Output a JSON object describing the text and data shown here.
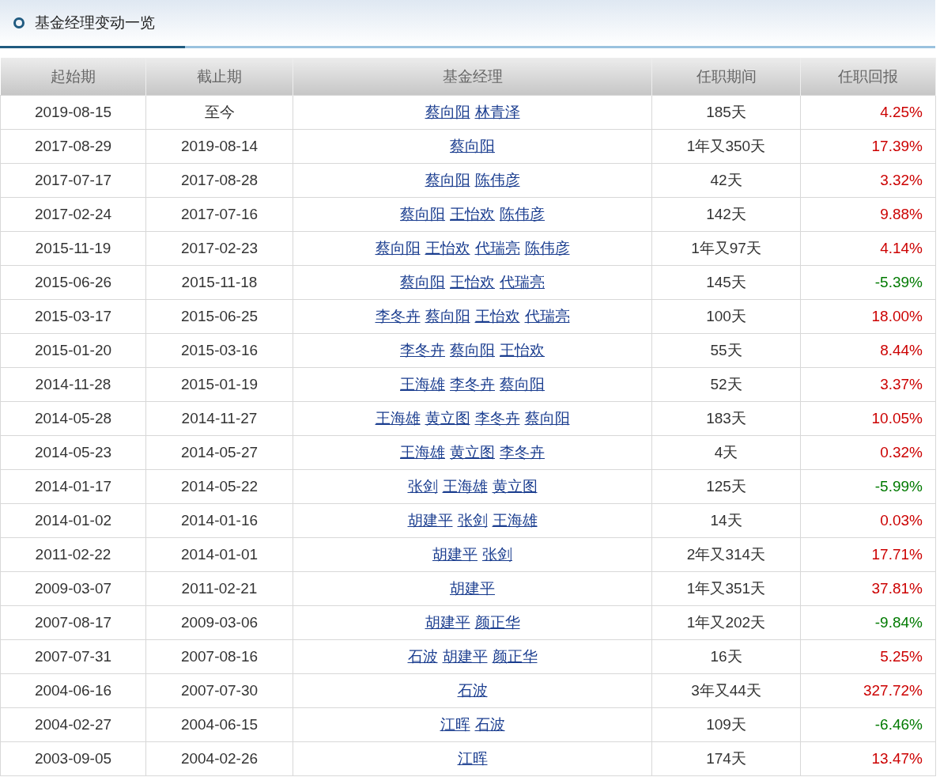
{
  "title": "基金经理变动一览",
  "table": {
    "columns": [
      "起始期",
      "截止期",
      "基金经理",
      "任职期间",
      "任职回报"
    ],
    "rows": [
      {
        "start": "2019-08-15",
        "end": "至今",
        "managers": [
          "蔡向阳",
          "林青泽"
        ],
        "tenure": "185天",
        "return": "4.25%",
        "color": "#cc0000"
      },
      {
        "start": "2017-08-29",
        "end": "2019-08-14",
        "managers": [
          "蔡向阳"
        ],
        "tenure": "1年又350天",
        "return": "17.39%",
        "color": "#cc0000"
      },
      {
        "start": "2017-07-17",
        "end": "2017-08-28",
        "managers": [
          "蔡向阳",
          "陈伟彦"
        ],
        "tenure": "42天",
        "return": "3.32%",
        "color": "#cc0000"
      },
      {
        "start": "2017-02-24",
        "end": "2017-07-16",
        "managers": [
          "蔡向阳",
          "王怡欢",
          "陈伟彦"
        ],
        "tenure": "142天",
        "return": "9.88%",
        "color": "#cc0000"
      },
      {
        "start": "2015-11-19",
        "end": "2017-02-23",
        "managers": [
          "蔡向阳",
          "王怡欢",
          "代瑞亮",
          "陈伟彦"
        ],
        "tenure": "1年又97天",
        "return": "4.14%",
        "color": "#cc0000"
      },
      {
        "start": "2015-06-26",
        "end": "2015-11-18",
        "managers": [
          "蔡向阳",
          "王怡欢",
          "代瑞亮"
        ],
        "tenure": "145天",
        "return": "-5.39%",
        "color": "#007a00"
      },
      {
        "start": "2015-03-17",
        "end": "2015-06-25",
        "managers": [
          "李冬卉",
          "蔡向阳",
          "王怡欢",
          "代瑞亮"
        ],
        "tenure": "100天",
        "return": "18.00%",
        "color": "#cc0000"
      },
      {
        "start": "2015-01-20",
        "end": "2015-03-16",
        "managers": [
          "李冬卉",
          "蔡向阳",
          "王怡欢"
        ],
        "tenure": "55天",
        "return": "8.44%",
        "color": "#cc0000"
      },
      {
        "start": "2014-11-28",
        "end": "2015-01-19",
        "managers": [
          "王海雄",
          "李冬卉",
          "蔡向阳"
        ],
        "tenure": "52天",
        "return": "3.37%",
        "color": "#cc0000"
      },
      {
        "start": "2014-05-28",
        "end": "2014-11-27",
        "managers": [
          "王海雄",
          "黄立图",
          "李冬卉",
          "蔡向阳"
        ],
        "tenure": "183天",
        "return": "10.05%",
        "color": "#cc0000"
      },
      {
        "start": "2014-05-23",
        "end": "2014-05-27",
        "managers": [
          "王海雄",
          "黄立图",
          "李冬卉"
        ],
        "tenure": "4天",
        "return": "0.32%",
        "color": "#cc0000"
      },
      {
        "start": "2014-01-17",
        "end": "2014-05-22",
        "managers": [
          "张剑",
          "王海雄",
          "黄立图"
        ],
        "tenure": "125天",
        "return": "-5.99%",
        "color": "#007a00"
      },
      {
        "start": "2014-01-02",
        "end": "2014-01-16",
        "managers": [
          "胡建平",
          "张剑",
          "王海雄"
        ],
        "tenure": "14天",
        "return": "0.03%",
        "color": "#cc0000"
      },
      {
        "start": "2011-02-22",
        "end": "2014-01-01",
        "managers": [
          "胡建平",
          "张剑"
        ],
        "tenure": "2年又314天",
        "return": "17.71%",
        "color": "#cc0000"
      },
      {
        "start": "2009-03-07",
        "end": "2011-02-21",
        "managers": [
          "胡建平"
        ],
        "tenure": "1年又351天",
        "return": "37.81%",
        "color": "#cc0000"
      },
      {
        "start": "2007-08-17",
        "end": "2009-03-06",
        "managers": [
          "胡建平",
          "颜正华"
        ],
        "tenure": "1年又202天",
        "return": "-9.84%",
        "color": "#007a00"
      },
      {
        "start": "2007-07-31",
        "end": "2007-08-16",
        "managers": [
          "石波",
          "胡建平",
          "颜正华"
        ],
        "tenure": "16天",
        "return": "5.25%",
        "color": "#cc0000"
      },
      {
        "start": "2004-06-16",
        "end": "2007-07-30",
        "managers": [
          "石波"
        ],
        "tenure": "3年又44天",
        "return": "327.72%",
        "color": "#cc0000"
      },
      {
        "start": "2004-02-27",
        "end": "2004-06-15",
        "managers": [
          "江晖",
          "石波"
        ],
        "tenure": "109天",
        "return": "-6.46%",
        "color": "#007a00"
      },
      {
        "start": "2003-09-05",
        "end": "2004-02-26",
        "managers": [
          "江晖"
        ],
        "tenure": "174天",
        "return": "13.47%",
        "color": "#cc0000"
      }
    ]
  }
}
